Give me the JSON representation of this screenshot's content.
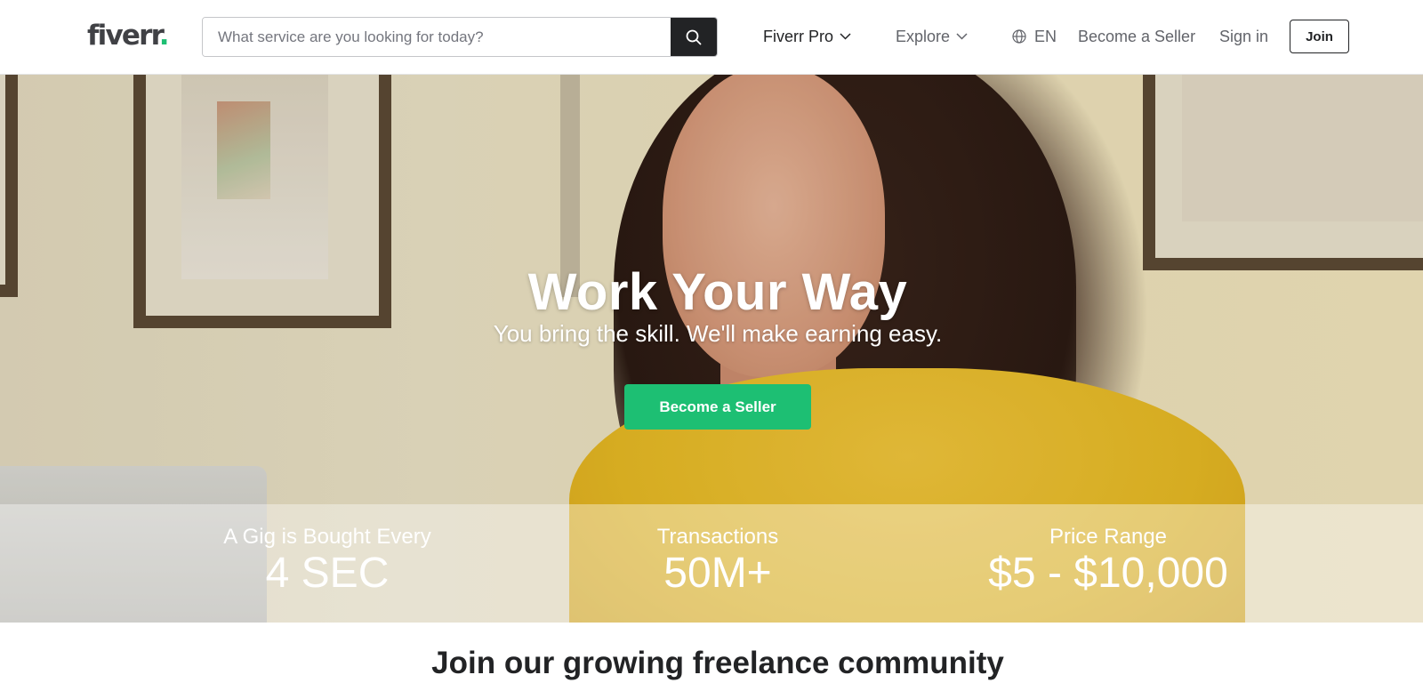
{
  "header": {
    "logo_text": "fiverr",
    "logo_dot": ".",
    "search_placeholder": "What service are you looking for today?",
    "nav": {
      "fiverr_pro": "Fiverr Pro",
      "explore": "Explore",
      "language": "EN",
      "become_seller": "Become a Seller",
      "sign_in": "Sign in",
      "join": "Join"
    }
  },
  "hero": {
    "title": "Work Your Way",
    "subtitle": "You bring the skill. We'll make earning easy.",
    "cta": "Become a Seller"
  },
  "stats": [
    {
      "label": "A Gig is Bought Every",
      "value": "4 SEC"
    },
    {
      "label": "Transactions",
      "value": "50M+"
    },
    {
      "label": "Price Range",
      "value": "$5 - $10,000"
    }
  ],
  "community": {
    "title": "Join our growing freelance community"
  },
  "colors": {
    "brand_green": "#1dbf73",
    "dark": "#222325",
    "muted": "#62646a"
  }
}
